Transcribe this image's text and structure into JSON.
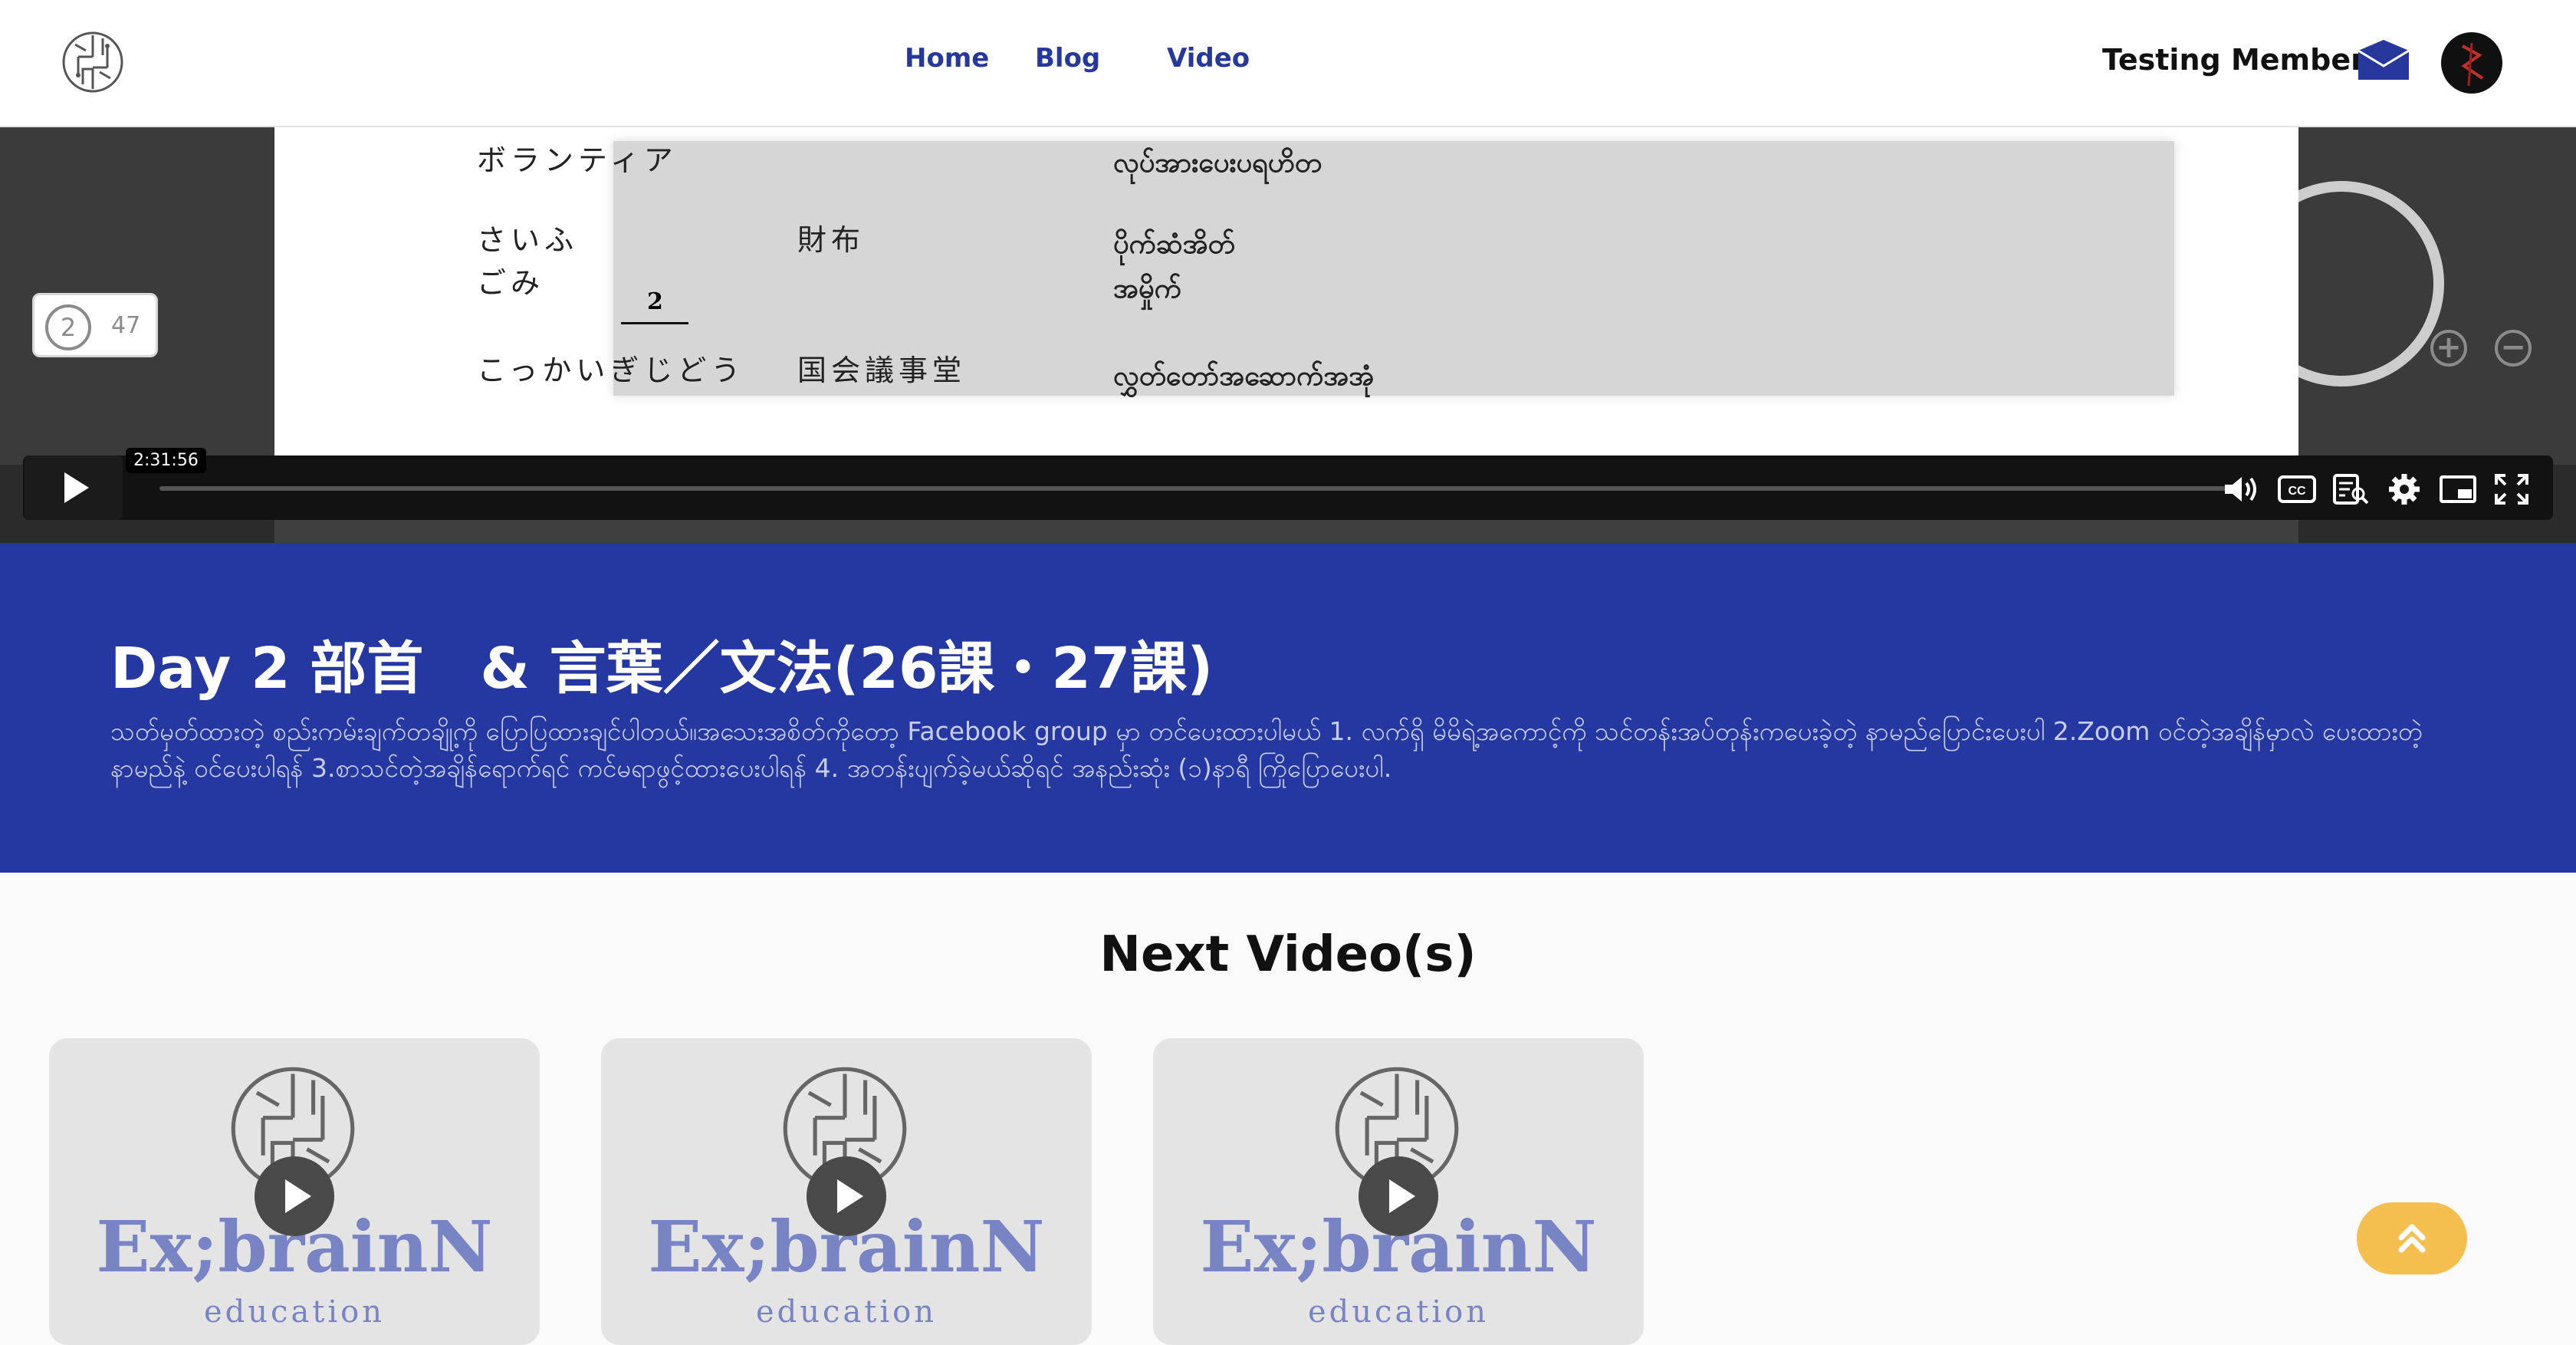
{
  "header": {
    "logo_icon": "brain-circuit-logo-icon",
    "nav": [
      "Home",
      "Blog",
      "Video"
    ],
    "user_name": "Testing Member",
    "mail_icon": "envelope-icon",
    "accent": "#27389c"
  },
  "video": {
    "document": {
      "rows": [
        {
          "jp": "ボランティア",
          "kanji": "",
          "mm": "လုပ်အားပေးပရဟိတ"
        },
        {
          "jp": "さいふ",
          "kanji": "財布",
          "mm": "ပိုက်ဆံအိတ်"
        },
        {
          "jp": "ごみ",
          "kanji": "",
          "mm": "အမှိုက်"
        },
        {
          "jp": "こっかいぎじどう",
          "kanji": "国会議事堂",
          "mm": "လွှတ်တော်အဆောက်အအုံ"
        }
      ],
      "page_marker": "2"
    },
    "page_badge": {
      "current": "2",
      "total": "47"
    },
    "zoom_in_icon": "plus-circle-icon",
    "zoom_out_icon": "minus-circle-icon",
    "player": {
      "play_icon": "play-icon",
      "time_tooltip": "2:31:56",
      "progress": 0.0,
      "icons": [
        "volume-icon",
        "captions-icon",
        "transcript-icon",
        "settings-gear-icon",
        "picture-in-picture-icon",
        "fullscreen-icon"
      ]
    }
  },
  "info": {
    "title": "Day 2 部首　& 言葉／文法(26課・27課)",
    "description": "သတ်မှတ်ထားတဲ့ စည်းကမ်းချက်တချို့ကို ပြောပြထားချင်ပါတယ်။အသေးအစိတ်ကိုတော့ Facebook group မှာ တင်ပေးထားပါမယ် 1. လက်ရှိ မိမိရဲ့အကောင့်ကို သင်တန်းအပ်တုန်းကပေးခဲ့တဲ့ နာမည်ပြောင်းပေးပါ 2.Zoom ဝင်တဲ့အချိန်မှာလဲ ပေးထားတဲ့ နာမည်နဲ့ ဝင်ပေးပါရန် 3.စာသင်တဲ့အချိန်ရောက်ရင် ကင်မရာဖွင့်ထားပေးပါရန် 4. အတန်းပျက်ခဲ့မယ်ဆိုရင် အနည်းဆုံး (၁)နာရီ ကြိုပြောပေးပါ.",
    "band_color": "#2537a0"
  },
  "next": {
    "heading": "Next Video(s)",
    "cards": [
      {
        "brand": "Ex;brainN",
        "sub": "education"
      },
      {
        "brand": "Ex;brainN",
        "sub": "education"
      },
      {
        "brand": "Ex;brainN",
        "sub": "education"
      }
    ]
  },
  "scroll_top_icon": "double-chevron-up-icon"
}
